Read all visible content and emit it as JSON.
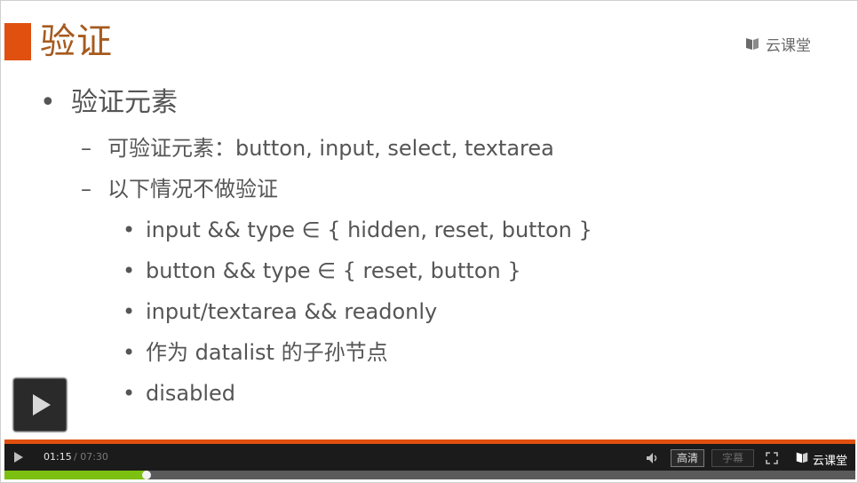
{
  "slide": {
    "title": "验证",
    "logo_text": "云课堂",
    "bullet_l1": "验证元素",
    "items_l2": [
      "可验证元素：button, input, select, textarea",
      "以下情况不做验证"
    ],
    "items_l3": [
      "input && type ∈ { hidden, reset, button }",
      "button && type ∈ { reset, button }",
      "input/textarea && readonly",
      "作为 datalist 的子孙节点",
      "disabled"
    ],
    "bullet_glyph": "•",
    "dash_glyph": "–"
  },
  "player": {
    "current_time": "01:15",
    "total_time": "/ 07:30",
    "hd_label": "高清",
    "subtitle_label": "字幕",
    "logo_text": "云课堂",
    "progress_fraction": 0.1667,
    "accent_color": "#e0500f",
    "progress_color": "#7cc012"
  }
}
